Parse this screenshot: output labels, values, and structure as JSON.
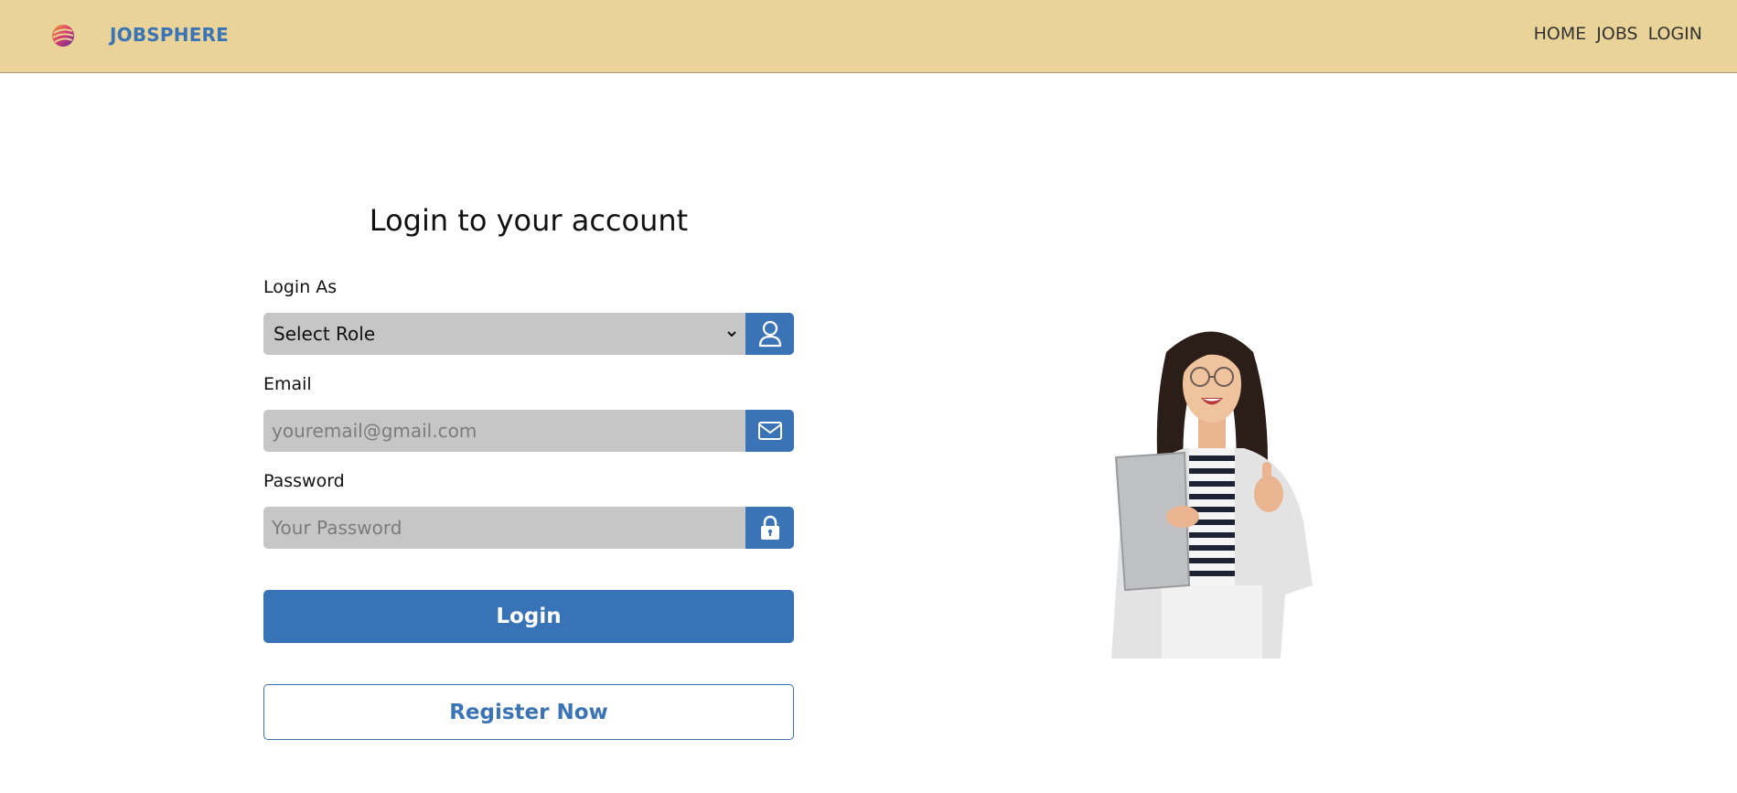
{
  "header": {
    "brand": "JOBSPHERE",
    "nav": [
      "HOME",
      "JOBS",
      "LOGIN"
    ]
  },
  "form": {
    "title": "Login to your account",
    "role": {
      "label": "Login As",
      "selected": "Select Role",
      "icon": "user-icon"
    },
    "email": {
      "label": "Email",
      "placeholder": "youremail@gmail.com",
      "value": "",
      "icon": "mail-icon"
    },
    "password": {
      "label": "Password",
      "placeholder": "Your Password",
      "value": "",
      "icon": "lock-icon"
    },
    "login_label": "Login",
    "register_label": "Register Now"
  },
  "colors": {
    "header_bg": "#e9d398",
    "primary": "#3773b6",
    "input_bg": "#c6c6c6"
  }
}
